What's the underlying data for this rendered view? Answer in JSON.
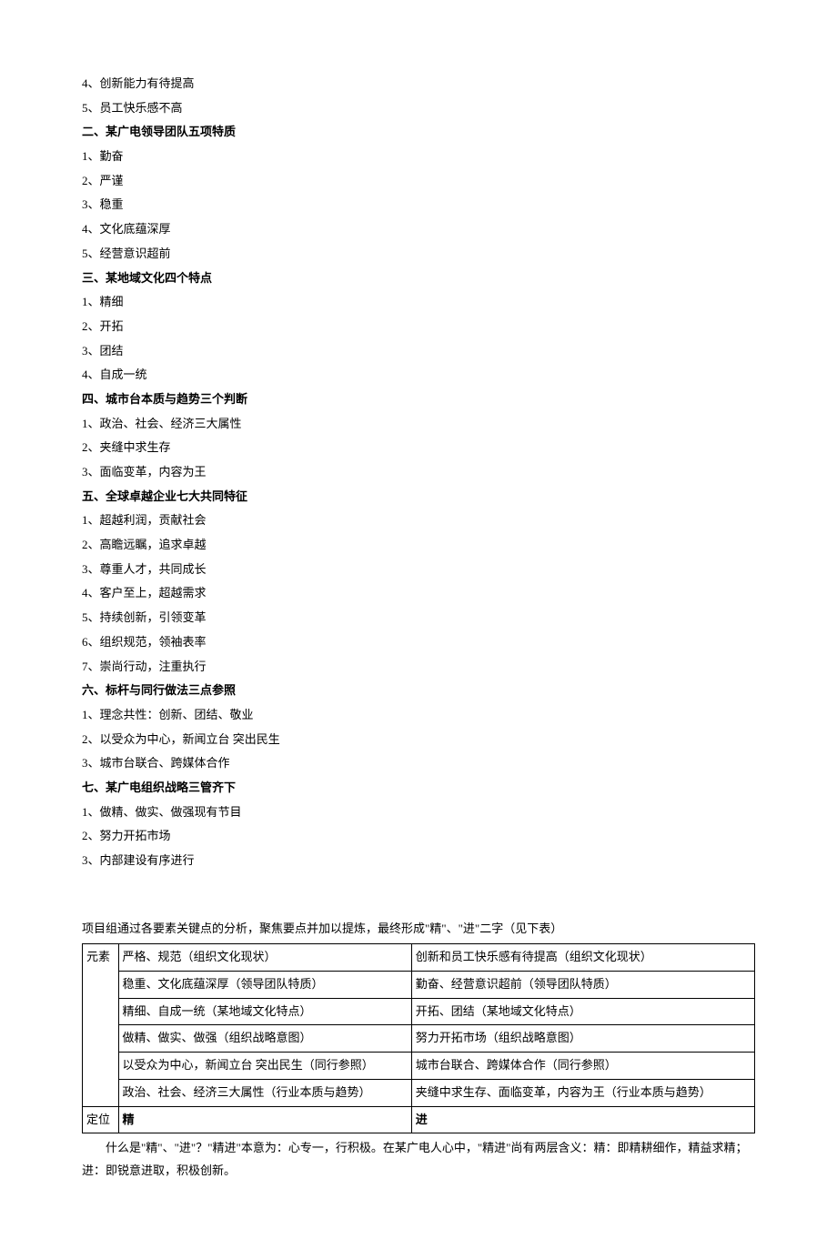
{
  "lines": [
    "4、创新能力有待提高",
    "5、员工快乐感不高"
  ],
  "sec2": {
    "title": "二、某广电领导团队五项特质",
    "items": [
      "1、勤奋",
      "2、严谨",
      "3、稳重",
      "4、文化底蕴深厚",
      "5、经营意识超前"
    ]
  },
  "sec3": {
    "title": "三、某地域文化四个特点",
    "items": [
      "1、精细",
      "2、开拓",
      "3、团结",
      "4、自成一统"
    ]
  },
  "sec4": {
    "title": "四、城市台本质与趋势三个判断",
    "items": [
      "1、政治、社会、经济三大属性",
      "2、夹缝中求生存",
      "3、面临变革，内容为王"
    ]
  },
  "sec5": {
    "title": "五、全球卓越企业七大共同特征",
    "items": [
      "1、超越利润，贡献社会",
      "2、高瞻远瞩，追求卓越",
      "3、尊重人才，共同成长",
      "4、客户至上，超越需求",
      "5、持续创新，引领变革",
      "6、组织规范，领袖表率",
      "7、崇尚行动，注重执行"
    ]
  },
  "sec6": {
    "title": "六、标杆与同行做法三点参照",
    "items": [
      "1、理念共性：创新、团结、敬业",
      "2、以受众为中心，新闻立台 突出民生",
      "3、城市台联合、跨媒体合作"
    ]
  },
  "sec7": {
    "title": "七、某广电组织战略三管齐下",
    "items": [
      "1、做精、做实、做强现有节目",
      "2、努力开拓市场",
      "3、内部建设有序进行"
    ]
  },
  "intro": "项目组通过各要素关键点的分析，聚焦要点并加以提炼，最终形成\"精\"、\"进\"二字（见下表）",
  "table": {
    "col1_header": "元素",
    "rows": [
      {
        "c2": "严格、规范（组织文化现状）",
        "c3": "创新和员工快乐感有待提高（组织文化现状）"
      },
      {
        "c2": "稳重、文化底蕴深厚（领导团队特质）",
        "c3": "勤奋、经营意识超前（领导团队特质）"
      },
      {
        "c2": "精细、自成一统（某地域文化特点）",
        "c3": "开拓、团结（某地域文化特点）"
      },
      {
        "c2": "做精、做实、做强（组织战略意图）",
        "c3": "努力开拓市场（组织战略意图）"
      },
      {
        "c2": "以受众为中心，新闻立台 突出民生（同行参照）",
        "c3": "城市台联合、跨媒体合作（同行参照）"
      },
      {
        "c2": "政治、社会、经济三大属性（行业本质与趋势）",
        "c3": "夹缝中求生存、面临变革，内容为王（行业本质与趋势）"
      }
    ],
    "footer": {
      "c1": "定位",
      "c2": "精",
      "c3": "进"
    }
  },
  "para": "什么是\"精\"、\"进\"？\"精进\"本意为：心专一，行积极。在某广电人心中，\"精进\"尚有两层含义：精：即精耕细作，精益求精；进：即锐意进取，积极创新。"
}
